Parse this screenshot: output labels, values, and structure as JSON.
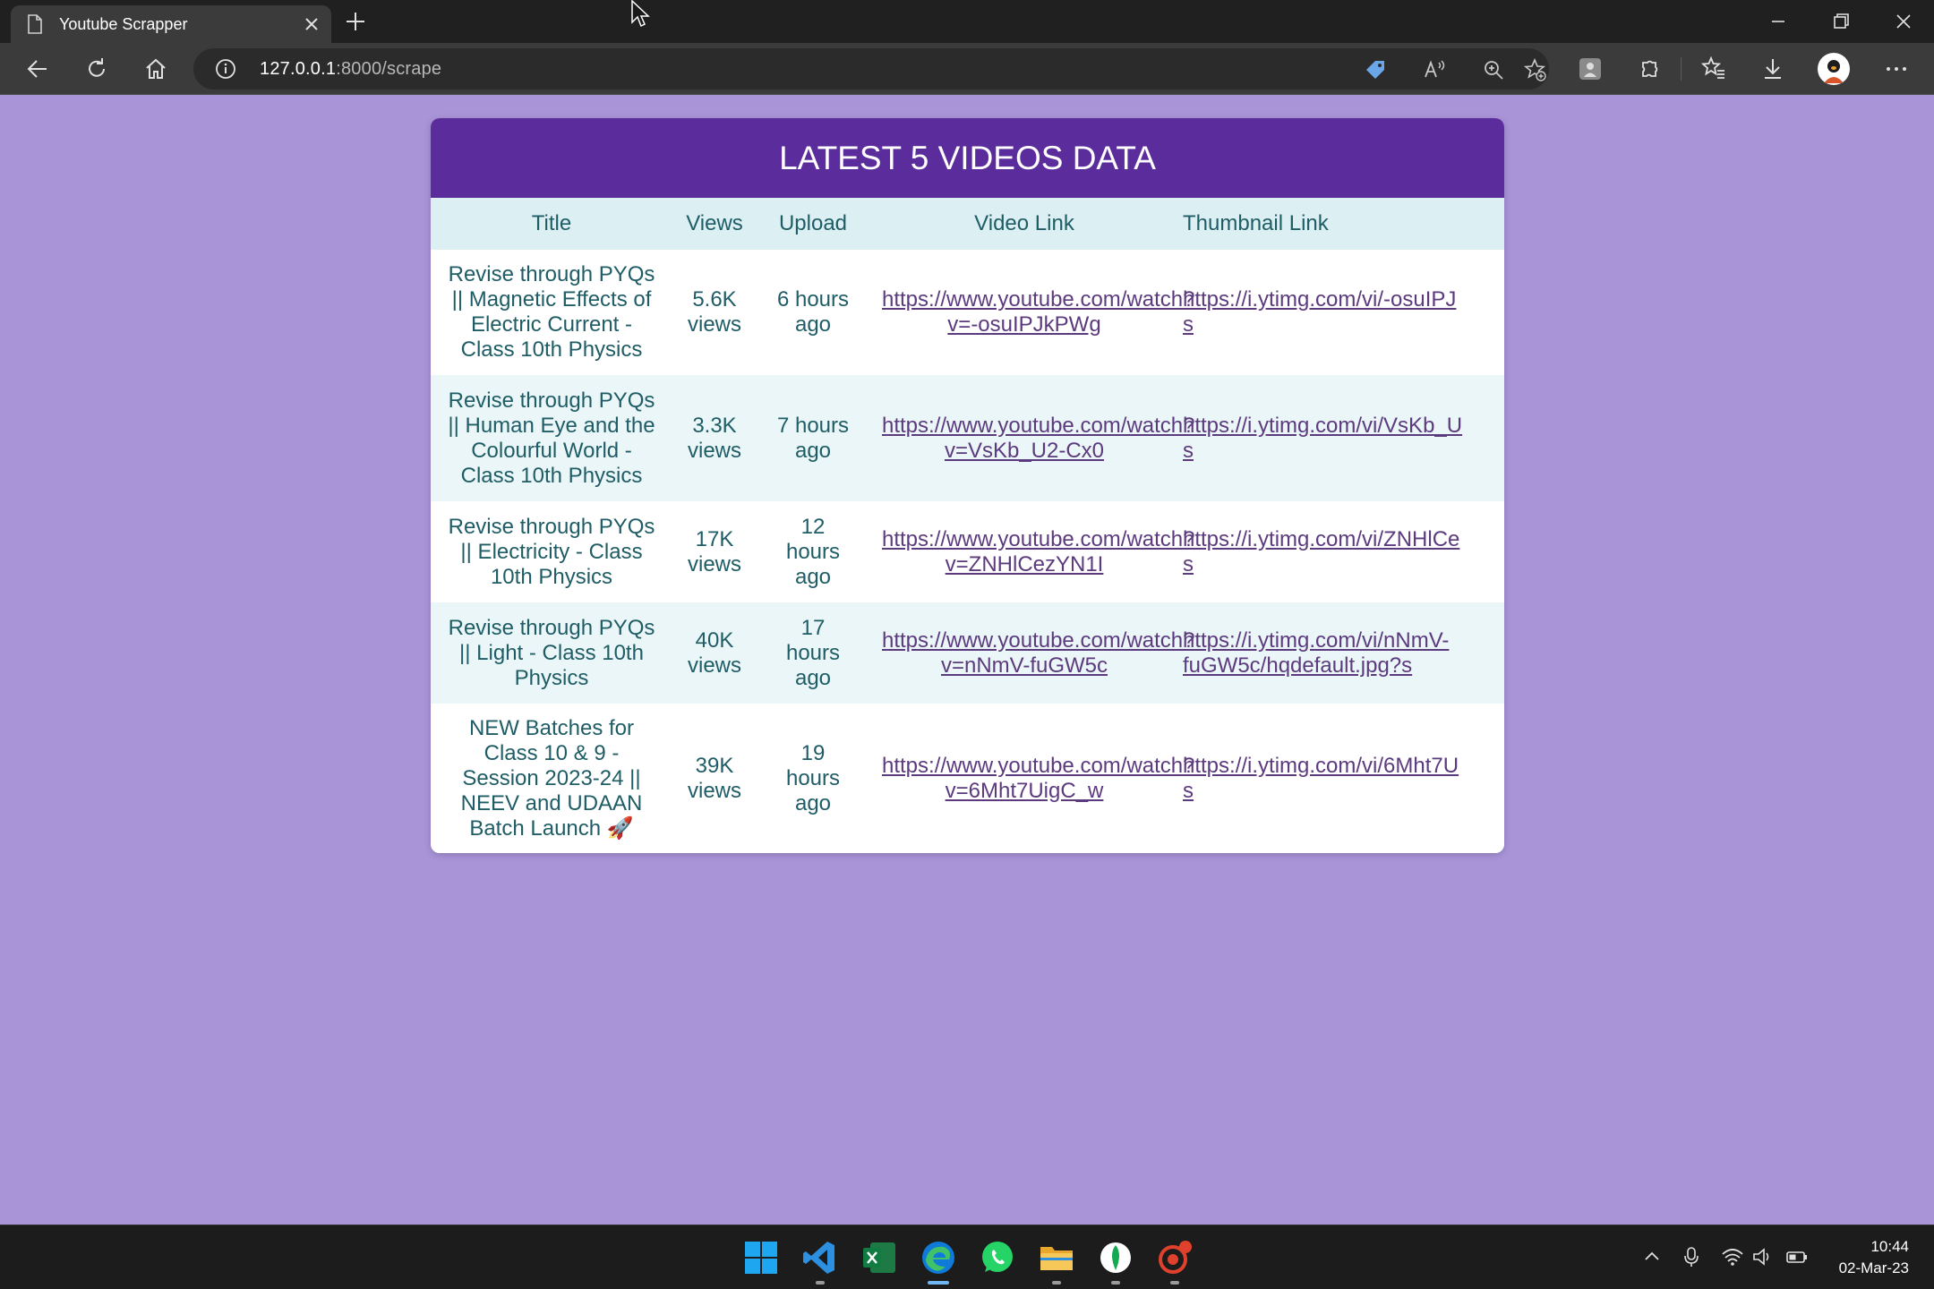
{
  "browser": {
    "tab_title": "Youtube Scrapper",
    "url_host": "127.0.0.1",
    "url_path": ":8000/scrape"
  },
  "page": {
    "heading": "LATEST 5 VIDEOS DATA",
    "columns": [
      "Title",
      "Views",
      "Upload",
      "Video Link",
      "Thumbnail Link"
    ],
    "rows": [
      {
        "title": "Revise through PYQs || Magnetic Effects of Electric Current - Class 10th Physics",
        "views": "5.6K views",
        "upload": "6 hours ago",
        "video_link": "https://www.youtube.com/watch?v=-osuIPJkPWg",
        "thumb_line1": "https://i.ytimg.com/vi/-osuIPJ",
        "thumb_line2": "s"
      },
      {
        "title": "Revise through PYQs || Human Eye and the Colourful World - Class 10th Physics",
        "views": "3.3K views",
        "upload": "7 hours ago",
        "video_link": "https://www.youtube.com/watch?v=VsKb_U2-Cx0",
        "thumb_line1": "https://i.ytimg.com/vi/VsKb_U",
        "thumb_line2": "s"
      },
      {
        "title": "Revise through PYQs || Electricity - Class 10th Physics",
        "views": "17K views",
        "upload": "12 hours ago",
        "video_link": "https://www.youtube.com/watch?v=ZNHlCezYN1I",
        "thumb_line1": "https://i.ytimg.com/vi/ZNHlCe",
        "thumb_line2": "s"
      },
      {
        "title": "Revise through PYQs || Light - Class 10th Physics",
        "views": "40K views",
        "upload": "17 hours ago",
        "video_link": "https://www.youtube.com/watch?v=nNmV-fuGW5c",
        "thumb_line1": "https://i.ytimg.com/vi/nNmV-",
        "thumb_line2": "fuGW5c/hqdefault.jpg?s"
      },
      {
        "title": "NEW Batches for Class 10 & 9 - Session 2023-24 || NEEV and UDAAN Batch Launch 🚀",
        "views": "39K views",
        "upload": "19 hours ago",
        "video_link": "https://www.youtube.com/watch?v=6Mht7UigC_w",
        "thumb_line1": "https://i.ytimg.com/vi/6Mht7U",
        "thumb_line2": "s"
      }
    ]
  },
  "taskbar": {
    "time": "10:44",
    "date": "02-Mar-23"
  },
  "colors": {
    "page_bg": "#a994d8",
    "header_bg": "#5b2c9b",
    "column_header_bg": "#dcf0f3",
    "text_teal": "#1f5d66",
    "link_purple": "#5c3a7e"
  }
}
